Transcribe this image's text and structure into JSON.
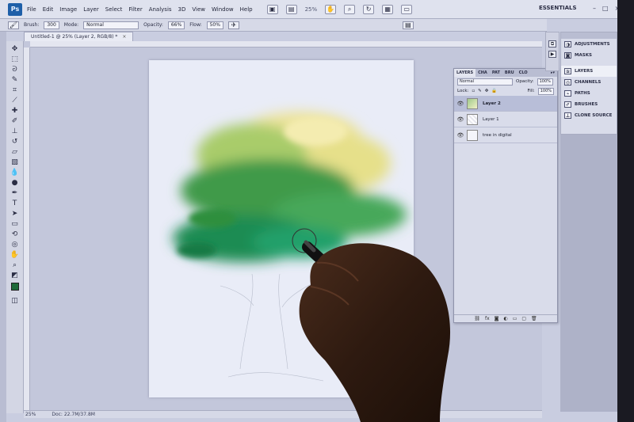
{
  "app": {
    "logo": "Ps",
    "menu": [
      "File",
      "Edit",
      "Image",
      "Layer",
      "Select",
      "Filter",
      "Analysis",
      "3D",
      "View",
      "Window",
      "Help"
    ],
    "zoom": "25%",
    "workspace": "ESSENTIALS"
  },
  "options": {
    "brush_label": "Brush:",
    "brush_size": "300",
    "mode_label": "Mode:",
    "mode_value": "Normal",
    "opacity_label": "Opacity:",
    "opacity_value": "66%",
    "flow_label": "Flow:",
    "flow_value": "50%"
  },
  "document": {
    "tab_title": "Untitled-1 @ 25% (Layer 2, RGB/8) *",
    "status_zoom": "25%",
    "status_doc": "Doc: 22.7M/37.8M"
  },
  "layers_panel": {
    "tabs": [
      "LAYERS",
      "CHA",
      "PAT",
      "BRU",
      "CLO"
    ],
    "blend_mode": "Normal",
    "opacity_label": "Opacity:",
    "opacity_value": "100%",
    "lock_label": "Lock:",
    "fill_label": "Fill:",
    "fill_value": "100%",
    "layers": [
      {
        "name": "Layer 2",
        "selected": true
      },
      {
        "name": "Layer 1",
        "selected": false
      },
      {
        "name": "tree in digital",
        "selected": false
      }
    ]
  },
  "dock": {
    "items": [
      "ADJUSTMENTS",
      "MASKS",
      "LAYERS",
      "CHANNELS",
      "PATHS",
      "BRUSHES",
      "CLONE SOURCE"
    ],
    "active": "LAYERS"
  },
  "colors": {
    "foreground": "#1f6b3a",
    "tree_dark": "#1f8a4c",
    "tree_light": "#e9e59a"
  }
}
